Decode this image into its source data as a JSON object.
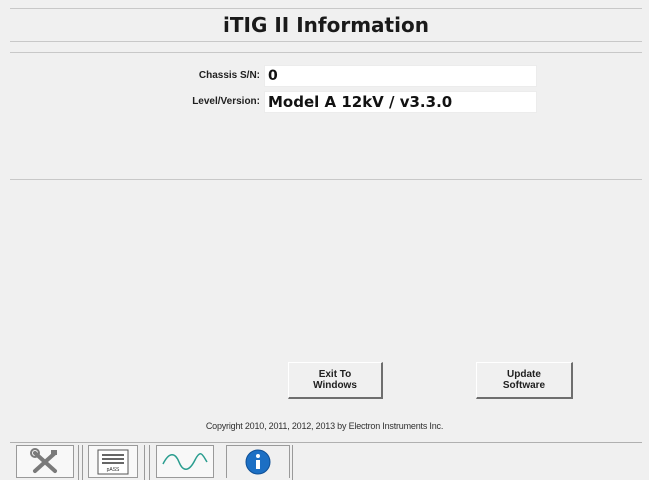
{
  "header": {
    "title": "iTIG II Information"
  },
  "info": {
    "chassis_label": "Chassis S/N:",
    "chassis_value": "0",
    "version_label": "Level/Version:",
    "version_value": "Model A 12kV / v3.3.0"
  },
  "buttons": {
    "exit_label": "Exit To\nWindows",
    "update_label": "Update\nSoftware"
  },
  "footer": {
    "copyright": "Copyright 2010, 2011, 2012, 2013 by Electron Instruments Inc."
  },
  "tabs": [
    {
      "icon": "wrench-screwdriver-icon"
    },
    {
      "icon": "pass-list-icon",
      "caption": "pASS"
    },
    {
      "icon": "waveform-icon"
    },
    {
      "icon": "info-icon",
      "selected": true
    }
  ],
  "colors": {
    "info_blue": "#1c6fc4",
    "wave_teal": "#2a9d8f"
  }
}
